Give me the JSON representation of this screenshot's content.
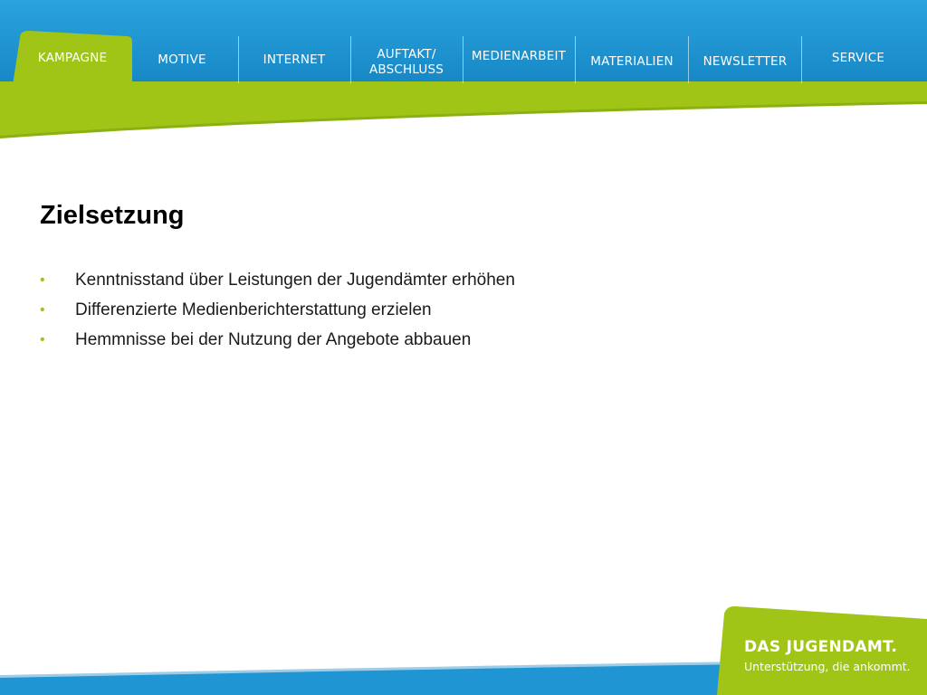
{
  "nav": {
    "items": [
      {
        "label": "KAMPAGNE",
        "active": true
      },
      {
        "label": "MOTIVE"
      },
      {
        "label": "INTERNET"
      },
      {
        "label": "AUFTAKT/\nABSCHLUSS"
      },
      {
        "label": "MEDIENARBEIT"
      },
      {
        "label": "MATERIALIEN"
      },
      {
        "label": "NEWSLETTER"
      },
      {
        "label": "SERVICE"
      }
    ]
  },
  "content": {
    "title": "Zielsetzung",
    "bullet_symbol": "•",
    "bullets": [
      "Kenntnisstand über Leistungen der Jugendämter erhöhen",
      "Differenzierte Medienberichterstattung erzielen",
      "Hemmnisse bei der Nutzung der Angebote abbauen"
    ]
  },
  "logo": {
    "title": "DAS JUGENDAMT.",
    "subtitle": "Unterstützung, die ankommt."
  },
  "colors": {
    "blue": "#1f96d3",
    "green": "#a0c516",
    "dark_green": "#86a90f"
  }
}
